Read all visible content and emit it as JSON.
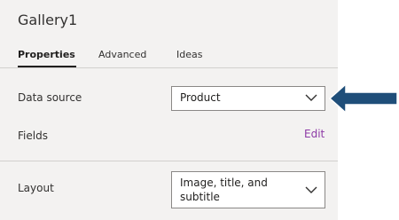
{
  "panel": {
    "title": "Gallery1"
  },
  "tabs": [
    {
      "label": "Properties",
      "active": true
    },
    {
      "label": "Advanced",
      "active": false
    },
    {
      "label": "Ideas",
      "active": false
    }
  ],
  "properties": {
    "data_source_label": "Data source",
    "data_source_value": "Product",
    "fields_label": "Fields",
    "fields_edit": "Edit",
    "layout_label": "Layout",
    "layout_value_line1": "Image, title, and",
    "layout_value_line2": "subtitle"
  },
  "colors": {
    "panel_bg": "#f3f2f1",
    "link": "#8d3aa6",
    "arrow": "#1f4e79"
  },
  "icons": {
    "dropdown": "chevron-down-icon",
    "annotation": "arrow-left-icon"
  }
}
